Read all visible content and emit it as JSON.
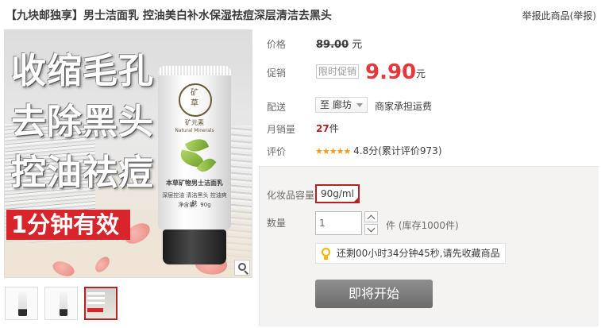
{
  "header": {
    "title": "【九块邮独享】男士洁面乳 控油美白补水保湿祛痘深层清洁去黑头",
    "report_link": "举报此商品(举报)"
  },
  "gallery": {
    "promo_lines": [
      "收缩毛孔",
      "去除黑头",
      "控油祛痘"
    ],
    "badge": "1分钟有效",
    "tube": {
      "logo_char_top": "矿",
      "logo_char_bottom": "草",
      "brand_cn": "矿元素",
      "brand_en": "Natural Minerals",
      "product_name": "本草矿物男士洁面乳",
      "small_text_1": "深层控油 清洁黑头 控油爽肤",
      "small_text_2": "净含量：90g"
    },
    "zoom_icon": "magnifier-icon",
    "thumbnails": [
      "thumb-1",
      "thumb-2",
      "thumb-3"
    ]
  },
  "price": {
    "label": "价格",
    "original": "89.00",
    "unit": "元"
  },
  "promo": {
    "label": "促销",
    "tag": "限时促销",
    "price": "9.90",
    "unit": "元"
  },
  "shipping": {
    "label": "配送",
    "destination": "至 廊坊",
    "note": "商家承担运费"
  },
  "sales": {
    "label": "月销量",
    "count": "27",
    "unit": "件"
  },
  "rating": {
    "label": "评价",
    "stars": "★★★★★",
    "score": "4.8分",
    "total": "(累计评价973)"
  },
  "options": {
    "spec_label": "化妆品容量",
    "spec_value": "90g/ml",
    "qty_label": "数量",
    "qty_value": "1",
    "stock": "件 (库存1000件)",
    "tip": "还剩00小时34分钟45秒,请先收藏商品",
    "buy_button": "即将开始"
  },
  "colors": {
    "accent_red": "#e4393c",
    "selected_border": "#b32323",
    "star": "#f39c12"
  }
}
